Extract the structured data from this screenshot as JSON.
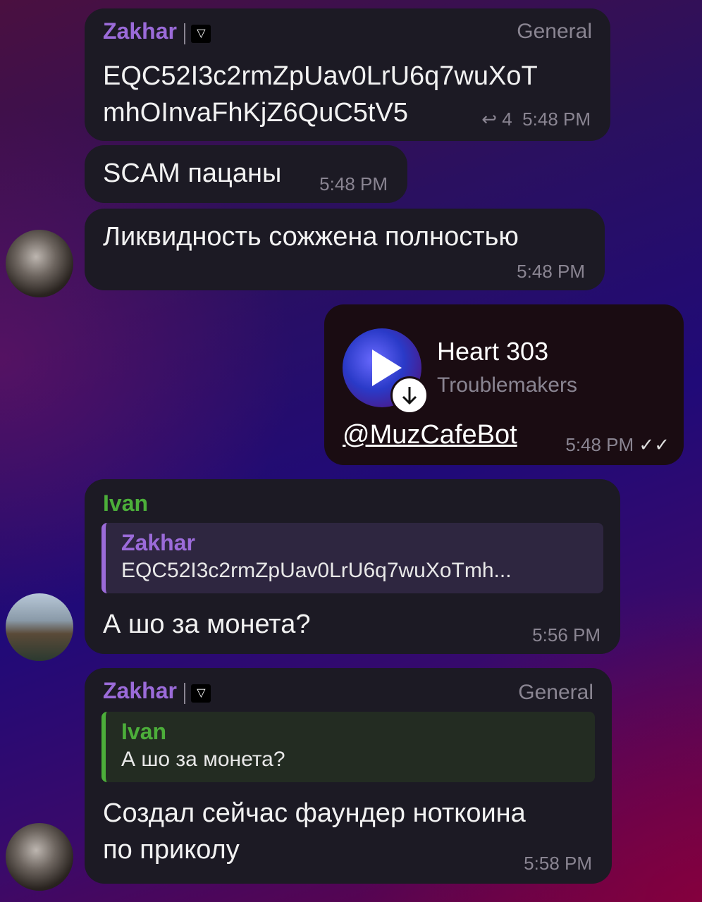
{
  "messages": {
    "m1": {
      "sender": "Zakhar",
      "tag": "General",
      "text_line1": "EQC52I3c2rmZpUav0LrU6q7wuXoT",
      "text_line2": "mhOInvaFhKjZ6QuC5tV5",
      "reply_count": "4",
      "time": "5:48 PM"
    },
    "m2": {
      "text": "SCAM пацаны",
      "time": "5:48 PM"
    },
    "m3": {
      "text": "Ликвидность сожжена полностью",
      "time": "5:48 PM"
    },
    "m4": {
      "track_title": "Heart 303",
      "track_artist": "Troublemakers",
      "bot_link": "@MuzCafeBot",
      "time": "5:48 PM",
      "read_status": "✓✓"
    },
    "m5": {
      "sender": "Ivan",
      "quote_name": "Zakhar",
      "quote_text": "EQC52I3c2rmZpUav0LrU6q7wuXoTmh...",
      "text": "А шо за монета?",
      "time": "5:56 PM"
    },
    "m6": {
      "sender": "Zakhar",
      "tag": "General",
      "quote_name": "Ivan",
      "quote_text": "А шо за монета?",
      "text_line1": "Создал сейчас фаундер ноткоина",
      "text_line2": "по приколу",
      "time": "5:58 PM"
    }
  },
  "badge_icon": "ton-diamond-flag-icon",
  "colors": {
    "name_purple": "#9b6bd9",
    "name_green": "#4cae3a"
  }
}
